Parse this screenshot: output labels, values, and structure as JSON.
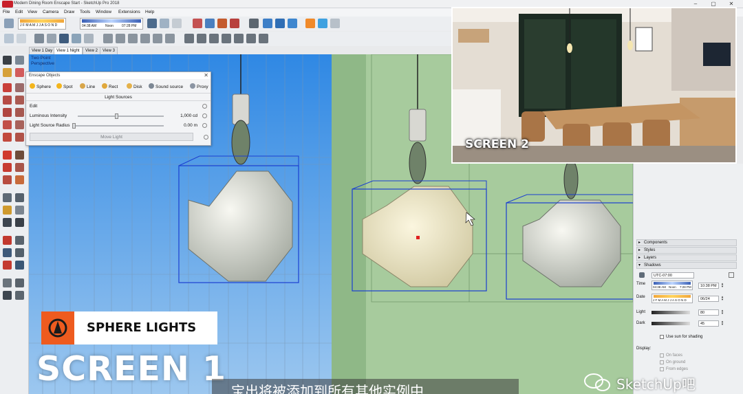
{
  "window": {
    "title": "Modern Dining Room Enscape Start - SketchUp Pro 2018",
    "controls": [
      "–",
      "▢",
      "✕"
    ]
  },
  "menu": [
    "File",
    "Edit",
    "View",
    "Camera",
    "Draw",
    "Tools",
    "Window",
    "Extensions",
    "Help"
  ],
  "toolbar": {
    "shadow_months": "J F M A M J J A S O N D",
    "shadow_time_start": "04:38 AM",
    "shadow_noon": "Noon",
    "shadow_time_end": "07:28 PM"
  },
  "scene_tabs": [
    {
      "label": "View 1 Day",
      "active": false
    },
    {
      "label": "View 1 Night",
      "active": true
    },
    {
      "label": "View 2",
      "active": false
    },
    {
      "label": "View 3",
      "active": false
    }
  ],
  "viewport": {
    "camera_line1": "Two Point",
    "camera_line2": "Perspective"
  },
  "enscape_objects": {
    "title": "Enscape Objects",
    "close": "✕",
    "types": [
      {
        "label": "Sphere",
        "color": "#f3b51d"
      },
      {
        "label": "Spot",
        "color": "#f3b51d"
      },
      {
        "label": "Line",
        "color": "#d8a64a"
      },
      {
        "label": "Rect",
        "color": "#e0a83c"
      },
      {
        "label": "Disk",
        "color": "#e4b14a"
      },
      {
        "label": "Sound source",
        "color": "#7c8794"
      },
      {
        "label": "Proxy",
        "color": "#8b95a3"
      }
    ],
    "section": "Light Sources",
    "edit_label": "Edit",
    "luminous_label": "Luminous Intensity",
    "luminous_value": "1,000 cd",
    "luminous_level": 0.45,
    "radius_label": "Light Source Radius",
    "radius_value": "0.00 m",
    "radius_level": 0.0,
    "move_light": "Move Light"
  },
  "screen2_label": "SCREEN 2",
  "trays": {
    "components": "Components",
    "styles": "Styles",
    "layers": "Layers",
    "shadows": "Shadows"
  },
  "shadows": {
    "timezone": "UTC-07:00",
    "time_label": "Time",
    "time_start": "04:38 AM",
    "noon": "Noon",
    "time_end": "7:28 PM",
    "time_value": "10:38 PM",
    "date_label": "Date",
    "months": "J F M A M J J A S O N D",
    "date_value": "06/24",
    "light_label": "Light",
    "light_value": "80",
    "dark_label": "Dark",
    "dark_value": "45",
    "use_sun_label": "Use sun for shading",
    "display_label": "Display:",
    "on_faces": "On faces",
    "on_ground": "On ground",
    "from_edges": "From edges"
  },
  "badge": {
    "text": "SPHERE LIGHTS",
    "color": "#ee5b1f"
  },
  "screen1_label": "SCREEN 1",
  "subtitle": "…宝出将被添加到所有其他实例中",
  "watermark": "SketchUp吧"
}
